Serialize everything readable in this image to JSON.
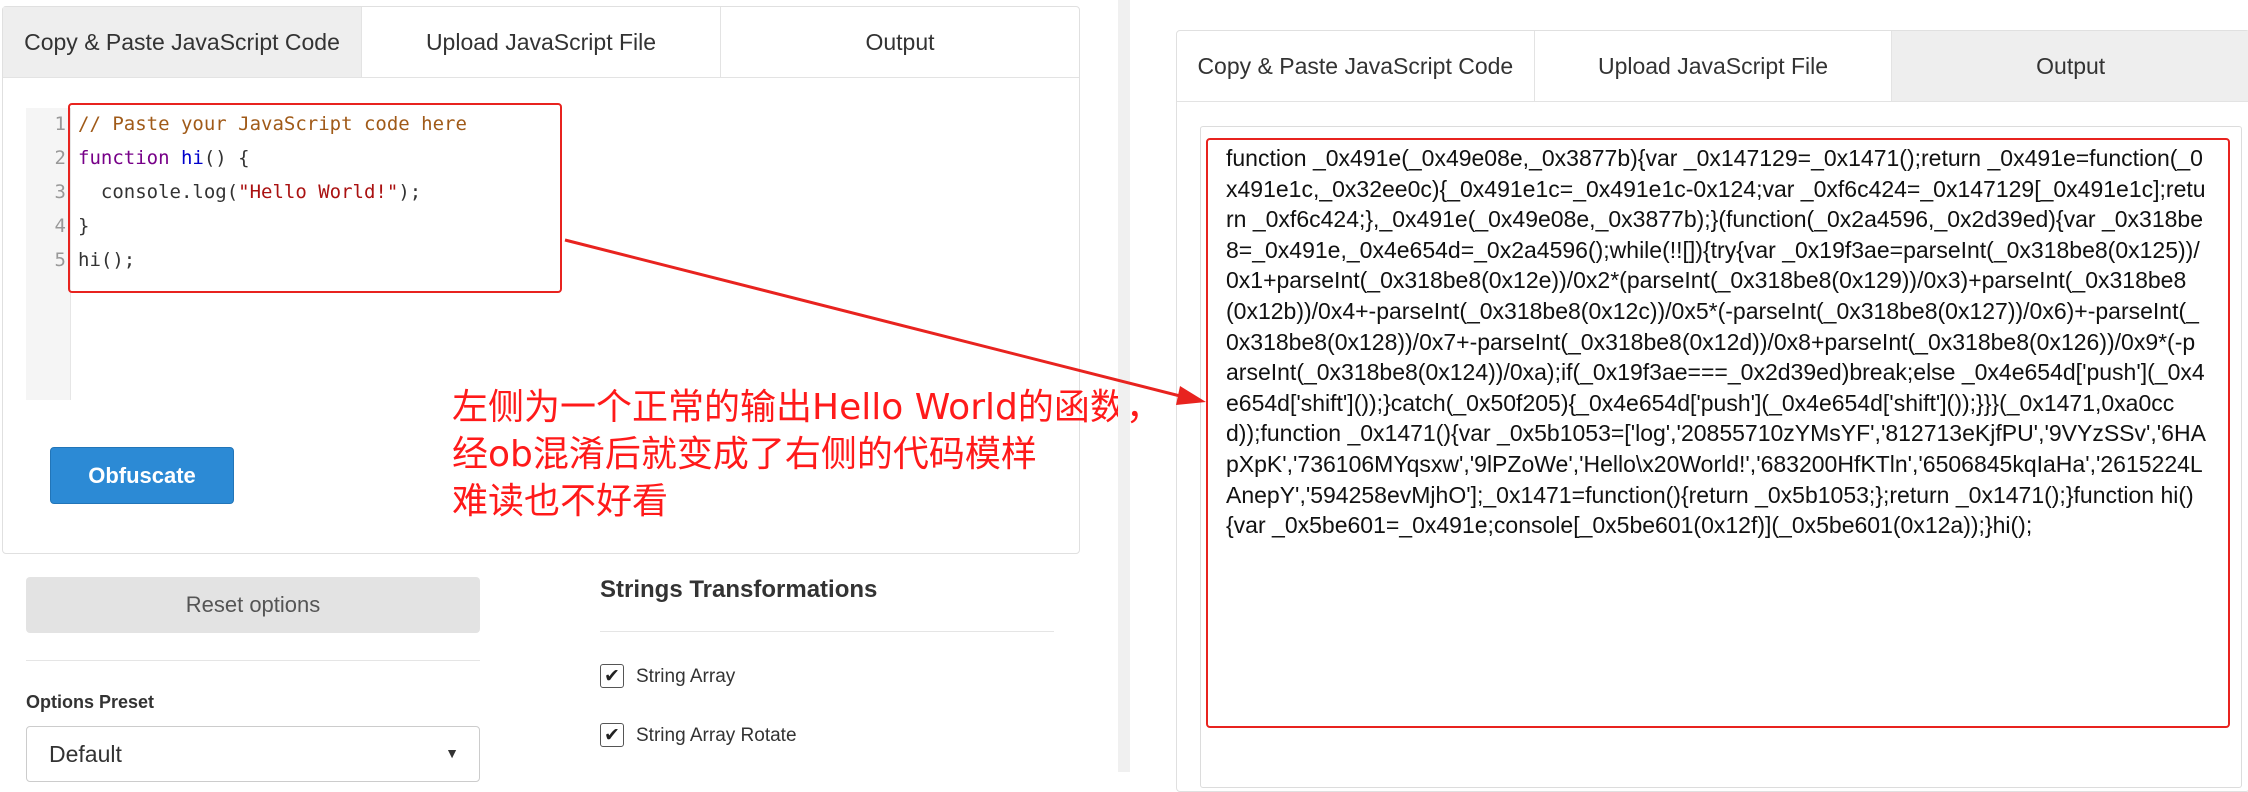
{
  "left": {
    "tabs": [
      {
        "label": "Copy & Paste JavaScript Code",
        "active": true
      },
      {
        "label": "Upload JavaScript File",
        "active": false
      },
      {
        "label": "Output",
        "active": false
      }
    ],
    "line_numbers": [
      "1",
      "2",
      "3",
      "4",
      "5"
    ],
    "code": {
      "line1": "// Paste your JavaScript code here",
      "line2_kw": "function",
      "line2_name": "hi",
      "line2_rest": "() {",
      "line3_a": "  console.log(",
      "line3_str": "\"Hello World!\"",
      "line3_b": ");",
      "line4": "}",
      "line5": "hi();"
    },
    "obfuscate_button": "Obfuscate",
    "reset_button": "Reset options",
    "options_preset_label": "Options Preset",
    "options_preset_value": "Default",
    "strings_transformations_title": "Strings Transformations",
    "checkboxes": [
      {
        "label": "String Array",
        "checked": true
      },
      {
        "label": "String Array Rotate",
        "checked": true
      }
    ]
  },
  "annotation": {
    "line1": "左侧为一个正常的输出Hello World的函数，",
    "line2": "经ob混淆后就变成了右侧的代码模样",
    "line3": "难读也不好看",
    "color": "#ff1a1a"
  },
  "right": {
    "tabs": [
      {
        "label": "Copy & Paste JavaScript Code",
        "active": false
      },
      {
        "label": "Upload JavaScript File",
        "active": false
      },
      {
        "label": "Output",
        "active": true
      }
    ],
    "output_code": "function _0x491e(_0x49e08e,_0x3877b){var _0x147129=_0x1471();return _0x491e=function(_0x491e1c,_0x32ee0c){_0x491e1c=_0x491e1c-0x124;var _0xf6c424=_0x147129[_0x491e1c];return _0xf6c424;},_0x491e(_0x49e08e,_0x3877b);}(function(_0x2a4596,_0x2d39ed){var _0x318be8=_0x491e,_0x4e654d=_0x2a4596();while(!![]){try{var _0x19f3ae=parseInt(_0x318be8(0x125))/0x1+parseInt(_0x318be8(0x12e))/0x2*(parseInt(_0x318be8(0x129))/0x3)+parseInt(_0x318be8(0x12b))/0x4+-parseInt(_0x318be8(0x12c))/0x5*(-parseInt(_0x318be8(0x127))/0x6)+-parseInt(_0x318be8(0x128))/0x7+-parseInt(_0x318be8(0x12d))/0x8+parseInt(_0x318be8(0x126))/0x9*(-parseInt(_0x318be8(0x124))/0xa);if(_0x19f3ae===_0x2d39ed)break;else _0x4e654d['push'](_0x4e654d['shift']());}catch(_0x50f205){_0x4e654d['push'](_0x4e654d['shift']());}}}(_0x1471,0xa0ccd));function _0x1471(){var _0x5b1053=['log','20855710zYMsYF','812713eKjfPU','9VYzSSv','6HApXpK','736106MYqsxw','9lPZoWe','Hello\\x20World!','683200HfKTln','6506845kqIaHa','2615224LAnepY','594258evMjhO'];_0x1471=function(){return _0x5b1053;};return _0x1471();}function hi(){var _0x5be601=_0x491e;console[_0x5be601(0x12f)](_0x5be601(0x12a));}hi();"
  }
}
